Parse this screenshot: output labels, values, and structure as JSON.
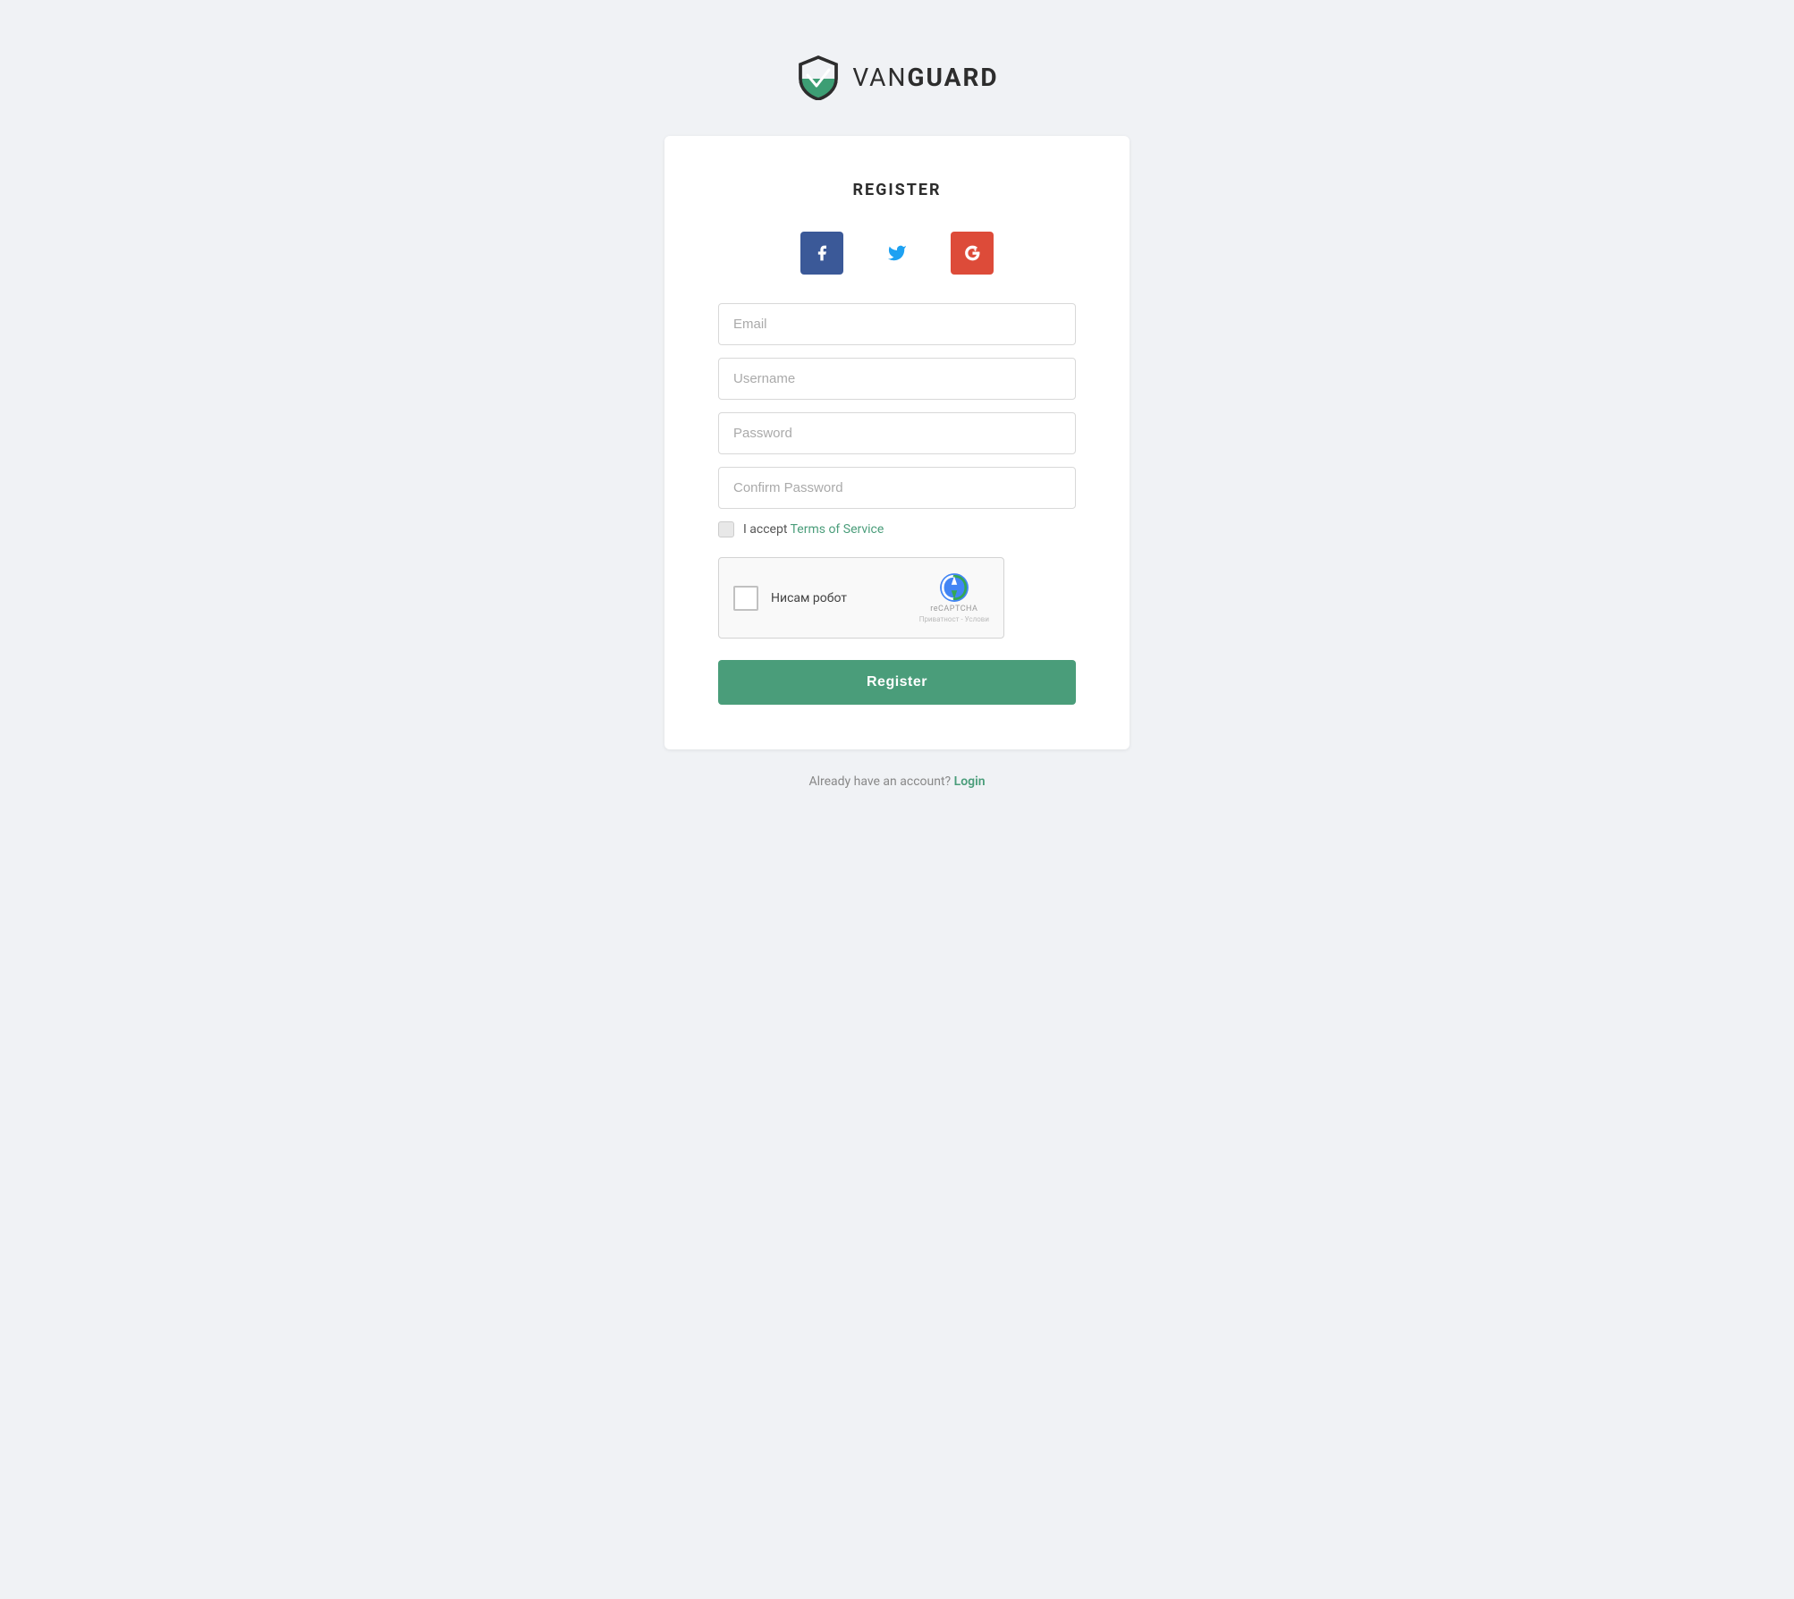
{
  "logo": {
    "text_van": "VAN",
    "text_guard": "GUARD",
    "alt": "VanGuard Logo"
  },
  "card": {
    "title": "REGISTER",
    "social": {
      "facebook_label": "Facebook",
      "twitter_label": "Twitter",
      "google_label": "Google+"
    },
    "fields": {
      "email_placeholder": "Email",
      "username_placeholder": "Username",
      "password_placeholder": "Password",
      "confirm_password_placeholder": "Confirm Password"
    },
    "terms": {
      "label": "I accept ",
      "link_text": "Terms of Service"
    },
    "captcha": {
      "text": "Нисам робот",
      "label": "reCAPTCHA",
      "sub": "Приватност - Услови"
    },
    "register_button": "Register",
    "login_prompt": "Already have an account?",
    "login_link": "Login"
  }
}
